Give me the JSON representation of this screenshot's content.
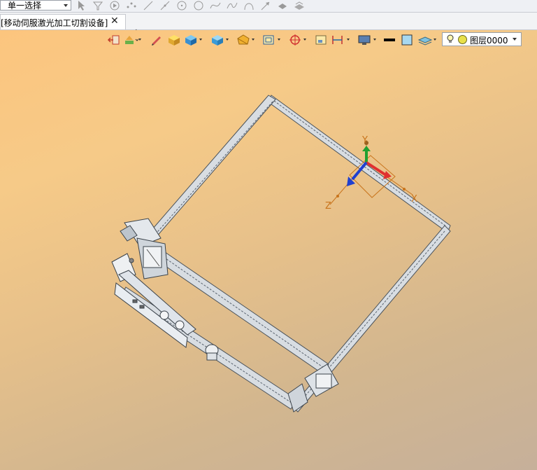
{
  "toolbar": {
    "selection_mode": "单一选择",
    "snap_icons": [
      "pointer-icon",
      "filter-icon",
      "play-icon",
      "points-icon",
      "line-icon",
      "line-icon",
      "circle-center-icon",
      "circle-icon",
      "spline-icon",
      "arc-icon",
      "arc-icon",
      "arrow-icon",
      "vertex-icon",
      "surface-icon"
    ]
  },
  "tabs": [
    {
      "title": "[移动伺服激光加工切割设备]",
      "active": true
    }
  ],
  "view_toolbar": {
    "icons": [
      "exit-icon",
      "display-style-icon",
      "edit-icon",
      "shaded-icon",
      "box-icon",
      "view-cube-icon",
      "section-icon",
      "wireframe-icon",
      "snap-target-icon",
      "fit-icon",
      "dimension-icon",
      "monitor-icon",
      "line-color-icon",
      "fill-color-icon",
      "layer-stack-icon"
    ],
    "layer": "图层0000"
  },
  "triad": {
    "x_label": "X",
    "y_label": "Y",
    "z_label": "Z"
  },
  "colors": {
    "x_axis": "#e03030",
    "y_axis": "#20a030",
    "z_axis": "#2040d0",
    "frame": "#6e7680",
    "orange_label": "#c8741c"
  }
}
